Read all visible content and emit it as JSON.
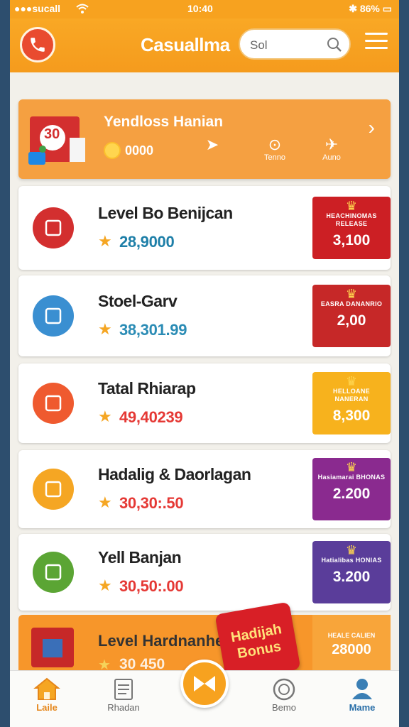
{
  "status": {
    "carrier": "●●●sucall",
    "time": "10:40",
    "battery": "86%"
  },
  "header": {
    "title": "Casuallma",
    "search_placeholder": "Sol"
  },
  "banner": {
    "badge_number": "30",
    "title": "Yendloss Hanian",
    "coins": "0000",
    "item_labels": [
      "Tenno",
      "Auno"
    ]
  },
  "list": [
    {
      "name": "Level Bo Benijcan",
      "score": "28,9000",
      "score_color": "#1e7fa8",
      "badge_label": "HEACHINOMAS RELEASE",
      "badge_value": "3,100",
      "badge_color": "#cc1f24",
      "thumb_color": "#d32f2f"
    },
    {
      "name": "Stoel-Garv",
      "score": "38,301.99",
      "score_color": "#2b8cb5",
      "badge_label": "EASRA DANANRIO",
      "badge_value": "2,00",
      "badge_color": "#c62828",
      "thumb_color": "#3a8fd1"
    },
    {
      "name": "Tatal Rhiarap",
      "score": "49,40239",
      "score_color": "#e53935",
      "badge_label": "HELLOANE NANERAN",
      "badge_value": "8,300",
      "badge_color": "#f7b21d",
      "thumb_color": "#ef5a2f"
    },
    {
      "name": "Hadalig & Daorlagan",
      "score": "30,30:.50",
      "score_color": "#e53935",
      "badge_label": "Hasiamarai BHONAS",
      "badge_value": "2.200",
      "badge_color": "#8a2a8f",
      "thumb_color": "#f5a623"
    },
    {
      "name": "Yell Banjan",
      "score": "30,50:.00",
      "score_color": "#e53935",
      "badge_label": "Hatialibas HONIAS",
      "badge_value": "3.200",
      "badge_color": "#5a3d9a",
      "thumb_color": "#5ba534"
    }
  ],
  "promo": {
    "name": "Level Hardnanhe",
    "score": "30 450",
    "badge_label": "HEALE CALIEN",
    "badge_value": "28000"
  },
  "bonus": {
    "line1": "Hadijah",
    "line2": "Bonus"
  },
  "nav": [
    {
      "label": "Laile",
      "icon": "home-icon"
    },
    {
      "label": "Rhadan",
      "icon": "document-icon"
    },
    {
      "label": "Bemo",
      "icon": "target-icon"
    },
    {
      "label": "Mame",
      "icon": "profile-icon"
    }
  ],
  "colors": {
    "accent": "#f7a21f",
    "header": "#f59b1d",
    "background": "#f2f0ea"
  }
}
